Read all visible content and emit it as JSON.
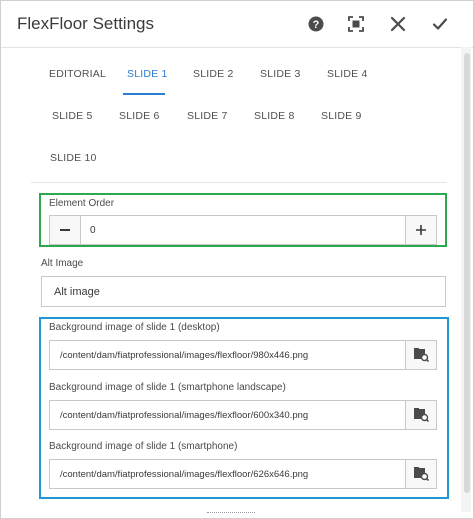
{
  "dialog": {
    "title": "FlexFloor Settings"
  },
  "header_icons": {
    "help": "help-icon",
    "fullscreen": "fullscreen-icon",
    "close": "close-icon",
    "confirm": "checkmark-icon"
  },
  "tabs": [
    {
      "label": "EDITORIAL",
      "active": false
    },
    {
      "label": "SLIDE 1",
      "active": true
    },
    {
      "label": "SLIDE 2",
      "active": false
    },
    {
      "label": "SLIDE 3",
      "active": false
    },
    {
      "label": "SLIDE 4",
      "active": false
    },
    {
      "label": "SLIDE 5",
      "active": false
    },
    {
      "label": "SLIDE 6",
      "active": false
    },
    {
      "label": "SLIDE 7",
      "active": false
    },
    {
      "label": "SLIDE 8",
      "active": false
    },
    {
      "label": "SLIDE 9",
      "active": false
    },
    {
      "label": "SLIDE 10",
      "active": false
    }
  ],
  "element_order": {
    "label": "Element Order",
    "value": "0"
  },
  "alt_image": {
    "label": "Alt Image",
    "value": "Alt image"
  },
  "backgrounds": [
    {
      "label": "Background image of slide 1 (desktop)",
      "value": "/content/dam/fiatprofessional/images/flexfloor/980x446.png"
    },
    {
      "label": "Background image of slide 1 (smartphone landscape)",
      "value": "/content/dam/fiatprofessional/images/flexfloor/600x340.png"
    },
    {
      "label": "Background image of slide 1 (smartphone)",
      "value": "/content/dam/fiatprofessional/images/flexfloor/626x646.png"
    }
  ],
  "colors": {
    "accent": "#2b7bd0",
    "highlight_green": "#2ea84b",
    "highlight_blue": "#1f98d1"
  }
}
